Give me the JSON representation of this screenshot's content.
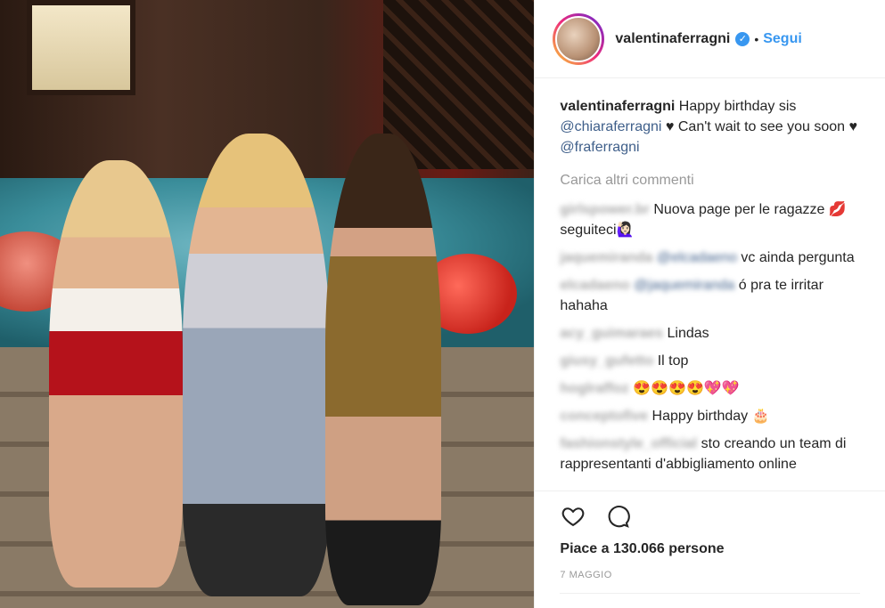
{
  "header": {
    "username": "valentinaferragni",
    "verified_icon": "verified-badge-icon",
    "separator": "•",
    "follow_label": "Segui"
  },
  "caption": {
    "username": "valentinaferragni",
    "text_1": "Happy birthday sis",
    "mention_1": "@chiaraferragni",
    "text_2": "♥ Can't wait to see you soon ♥",
    "mention_2": "@fraferragni"
  },
  "load_more": "Carica altri commenti",
  "comments": [
    {
      "username": "girlspower.br",
      "text": "Nuova page per le ragazze 💋 seguiteci🙋🏻‍♀️"
    },
    {
      "username": "jaquemiranda",
      "mention": "@elcadaeno",
      "text": "vc ainda pergunta"
    },
    {
      "username": "elcadaeno",
      "mention": "@jaquemiranda",
      "text": "ó pra te irritar hahaha"
    },
    {
      "username": "acy_guimaraes",
      "text": "Lindas"
    },
    {
      "username": "giusy_gufetto",
      "text": "Il top"
    },
    {
      "username": "hoglraffoz",
      "text": "😍😍😍😍💖💖"
    },
    {
      "username": "conceptofive",
      "text": "Happy birthday 🎂"
    },
    {
      "username": "fashionstyle_official",
      "text": "sto creando un team di rappresentanti d'abbigliamento online"
    }
  ],
  "actions": {
    "like_icon": "heart-icon",
    "comment_icon": "comment-icon",
    "likes_text": "Piace a 130.066 persone",
    "date": "7 MAGGIO"
  }
}
